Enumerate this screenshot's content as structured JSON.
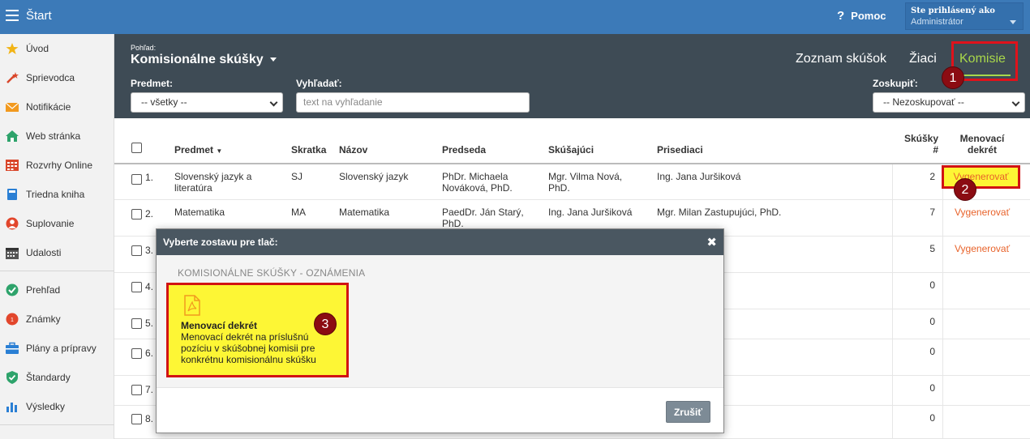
{
  "topbar": {
    "start_label": "Štart",
    "help_label": "Pomoc",
    "user_line1": "Ste prihlásený ako",
    "user_line2": "Administrátor"
  },
  "sidebar": {
    "items": [
      {
        "label": "Úvod",
        "icon": "star-icon"
      },
      {
        "label": "Sprievodca",
        "icon": "wand-icon"
      },
      {
        "label": "Notifikácie",
        "icon": "envelope-icon"
      },
      {
        "label": "Web stránka",
        "icon": "home-icon"
      },
      {
        "label": "Rozvrhy Online",
        "icon": "timetable-icon"
      },
      {
        "label": "Triedna kniha",
        "icon": "book-icon"
      },
      {
        "label": "Suplovanie",
        "icon": "person-icon"
      },
      {
        "label": "Udalosti",
        "icon": "calendar-icon"
      },
      {
        "label": "Prehľad",
        "icon": "check-circle-icon"
      },
      {
        "label": "Známky",
        "icon": "grades-icon"
      },
      {
        "label": "Plány a prípravy",
        "icon": "briefcase-icon"
      },
      {
        "label": "Štandardy",
        "icon": "shield-check-icon"
      },
      {
        "label": "Výsledky",
        "icon": "bar-chart-icon"
      }
    ]
  },
  "header": {
    "view_label": "Pohľad:",
    "view_title": "Komisionálne skúšky",
    "tabs": [
      "Zoznam skúšok",
      "Žiaci",
      "Komisie"
    ],
    "filter_subject_label": "Predmet:",
    "filter_subject_value": "-- všetky --",
    "search_label": "Vyhľadať:",
    "search_placeholder": "text na vyhľadanie",
    "group_label": "Zoskupiť:",
    "group_value": "-- Nezoskupovať --"
  },
  "annotations": [
    "1",
    "2",
    "3"
  ],
  "table": {
    "headers": {
      "predmet": "Predmet",
      "skratka": "Skratka",
      "nazov": "Názov",
      "predseda": "Predseda",
      "skusajuci": "Skúšajúci",
      "prisediaci": "Prisediaci",
      "skusky_line1": "Skúšky",
      "skusky_line2": "#",
      "dekret_line1": "Menovací",
      "dekret_line2": "dekrét"
    },
    "rows": [
      {
        "num": "1.",
        "predmet": "Slovenský jazyk a literatúra",
        "skratka": "SJ",
        "nazov": "Slovenský jazyk",
        "predseda": "PhDr. Michaela Nováková, PhD.",
        "skusajuci": "Mgr. Vilma Nová, PhD.",
        "prisediaci": "Ing. Jana Juršiková",
        "count": "2",
        "action": "Vygenerovať"
      },
      {
        "num": "2.",
        "predmet": "Matematika",
        "skratka": "MA",
        "nazov": "Matematika",
        "predseda": "PaedDr. Ján Starý, PhD.",
        "skusajuci": "Ing. Jana Juršiková",
        "prisediaci": "Mgr. Milan Zastupujúci, PhD.",
        "count": "7",
        "action": "Vygenerovať"
      },
      {
        "num": "3.",
        "count": "5",
        "action": "Vygenerovať"
      },
      {
        "num": "4.",
        "count": "0"
      },
      {
        "num": "5.",
        "count": "0"
      },
      {
        "num": "6.",
        "count": "0"
      },
      {
        "num": "7.",
        "count": "0"
      },
      {
        "num": "8.",
        "count": "0"
      }
    ]
  },
  "modal": {
    "title": "Vyberte zostavu pre tlač:",
    "close": "✖",
    "section": "KOMISIONÁLNE SKÚŠKY - OZNÁMENIA",
    "card_title": "Menovací dekrét",
    "card_desc": "Menovací dekrét na príslušnú pozíciu v skúšobnej komisii pre konkrétnu komisionálnu skúšku",
    "cancel": "Zrušiť"
  }
}
